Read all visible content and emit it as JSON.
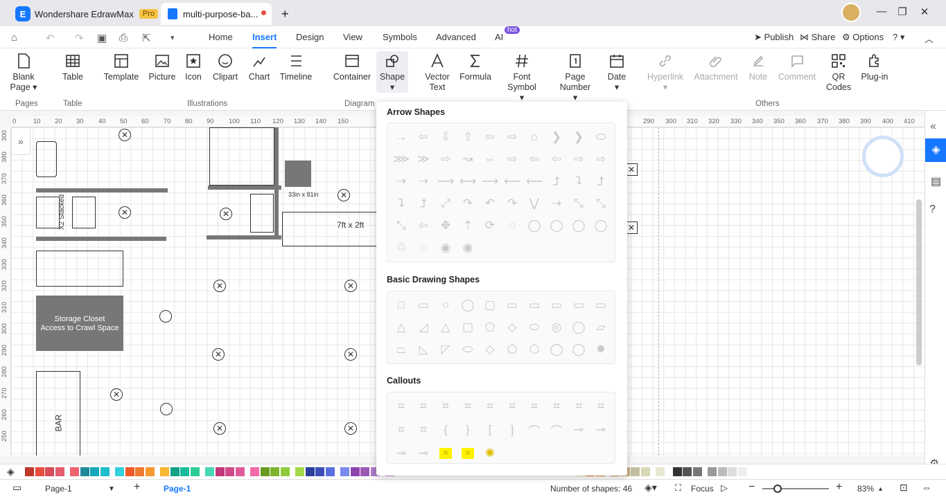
{
  "tabs": {
    "app_title": "Wondershare EdrawMax",
    "pro_badge": "Pro",
    "doc_title": "multi-purpose-ba...",
    "new_tab": "+"
  },
  "menu": {
    "items": [
      "Home",
      "Insert",
      "Design",
      "View",
      "Symbols",
      "Advanced",
      "AI"
    ],
    "hot_badge": "hot",
    "publish": "Publish",
    "share": "Share",
    "options": "Options"
  },
  "ribbon": {
    "buttons": [
      {
        "label1": "Blank",
        "label2": "Page ▾"
      },
      {
        "label1": "Table",
        "label2": ""
      },
      {
        "label1": "Template",
        "label2": ""
      },
      {
        "label1": "Picture",
        "label2": ""
      },
      {
        "label1": "Icon",
        "label2": ""
      },
      {
        "label1": "Clipart",
        "label2": ""
      },
      {
        "label1": "Chart",
        "label2": ""
      },
      {
        "label1": "Timeline",
        "label2": ""
      },
      {
        "label1": "Container",
        "label2": ""
      },
      {
        "label1": "Shape",
        "label2": "▾"
      },
      {
        "label1": "Vector",
        "label2": "Text"
      },
      {
        "label1": "Formula",
        "label2": ""
      },
      {
        "label1": "Font",
        "label2": "Symbol ▾"
      },
      {
        "label1": "Page",
        "label2": "Number ▾"
      },
      {
        "label1": "Date",
        "label2": "▾"
      },
      {
        "label1": "Hyperlink",
        "label2": "▾"
      },
      {
        "label1": "Attachment",
        "label2": ""
      },
      {
        "label1": "Note",
        "label2": ""
      },
      {
        "label1": "Comment",
        "label2": ""
      },
      {
        "label1": "QR",
        "label2": "Codes"
      },
      {
        "label1": "Plug-in",
        "label2": ""
      }
    ],
    "groups": [
      "Pages",
      "Table",
      "Illustrations",
      "Diagram",
      "Others"
    ]
  },
  "ruler": {
    "h": [
      "0",
      "10",
      "20",
      "30",
      "40",
      "50",
      "60",
      "70",
      "80",
      "90",
      "100",
      "110",
      "120",
      "130",
      "140",
      "150",
      "290",
      "300",
      "310",
      "320",
      "330",
      "340",
      "350",
      "360",
      "370",
      "380",
      "390",
      "400",
      "410"
    ],
    "v": [
      "300",
      "380",
      "370",
      "360",
      "350",
      "340",
      "330",
      "320",
      "310",
      "300",
      "290",
      "280",
      "270",
      "260",
      "250"
    ]
  },
  "canvas": {
    "label_storage1": "Storage Closet",
    "label_storage2": "Access to Crawl Space",
    "label_bar": "BAR",
    "label_stacked": "X2 Stacked",
    "label_dim1": "33in x 81in",
    "label_dim2": "7ft x 2ft"
  },
  "dropdown": {
    "section_arrow": "Arrow Shapes",
    "section_basic": "Basic Drawing Shapes",
    "section_callouts": "Callouts",
    "arrow_glyphs": [
      "→",
      "⇦",
      "⇩",
      "⇧",
      "⇦",
      "⇨",
      "⌂",
      "❯",
      "❯",
      "⬭",
      "⋙",
      "≫",
      "⇨",
      "↝",
      "⇔",
      "⇨",
      "⇦",
      "⇦",
      "⇨",
      "⇨",
      "⇢",
      "⇢",
      "⟶",
      "⟷",
      "⟶",
      "⟵",
      "⟵",
      "⮥",
      "⮧",
      "⮥",
      "⮧",
      "⮥",
      "⤢",
      "↷",
      "↶",
      "↷",
      "⋁",
      "⇢",
      "⤡",
      "⤡",
      "⤡",
      "⇦",
      "✥",
      "⇡",
      "⟳",
      "◌",
      "◯",
      "◯",
      "◯",
      "◯",
      "♲",
      "◌",
      "◉",
      "◉"
    ],
    "basic_glyphs": [
      "□",
      "▭",
      "○",
      "◯",
      "▢",
      "▭",
      "▭",
      "▭",
      "▭",
      "▭",
      "△",
      "◿",
      "△",
      "▢",
      "⬠",
      "◇",
      "⬭",
      "◎",
      "◯",
      "▱",
      "⏢",
      "◺",
      "◸",
      "⬭",
      "◇",
      "⬠",
      "⬡",
      "◯",
      "◯",
      "✹"
    ],
    "callout_glyphs": [
      "⌗",
      "⌗",
      "⌗",
      "⌗",
      "⌗",
      "⌗",
      "⌗",
      "⌗",
      "⌗",
      "⌗",
      "⌗",
      "⌗",
      "{",
      "}",
      "[",
      "]",
      "⌒",
      "⌒",
      "⊸",
      "⊸",
      "⊸",
      "⊸",
      "⌗",
      "⌗",
      "✺"
    ]
  },
  "palette": [
    "#c0392b",
    "#e74c3c",
    "#d94b5a",
    "#e55c70",
    "#f06270",
    "#1e8a9a",
    "#16a8b8",
    "#1cbfcc",
    "#36d0dc",
    "#f05a28",
    "#f07a30",
    "#f59a30",
    "#f7b731",
    "#16a085",
    "#1abc9c",
    "#2ecc9a",
    "#48d6b4",
    "#c0387a",
    "#d04a8a",
    "#e05a9a",
    "#f06aaa",
    "#6a9a22",
    "#7cb32c",
    "#8fcc3a",
    "#a4d84a",
    "#2c3e9a",
    "#3a4eb8",
    "#5b6ee0",
    "#7a8aee",
    "#8e44ad",
    "#9b59b6",
    "#b07cc6",
    "#c59ad6",
    "#f5e6a0",
    "#e67e22",
    "#e8902a",
    "#d6a060",
    "#c8b080",
    "#c0c0a0",
    "#d8d8b8",
    "#e8e8d0",
    "#333333",
    "#555555",
    "#777777",
    "#999999",
    "#bbbbbb",
    "#dddddd",
    "#eeeeee"
  ],
  "status": {
    "page_tab": "Page-1",
    "page_current": "Page-1",
    "add_page": "+",
    "shape_count": "Number of shapes: 46",
    "focus": "Focus",
    "zoom": "83%"
  },
  "colors": {
    "accent": "#1677ff",
    "selected_bg": "#eceef2"
  }
}
